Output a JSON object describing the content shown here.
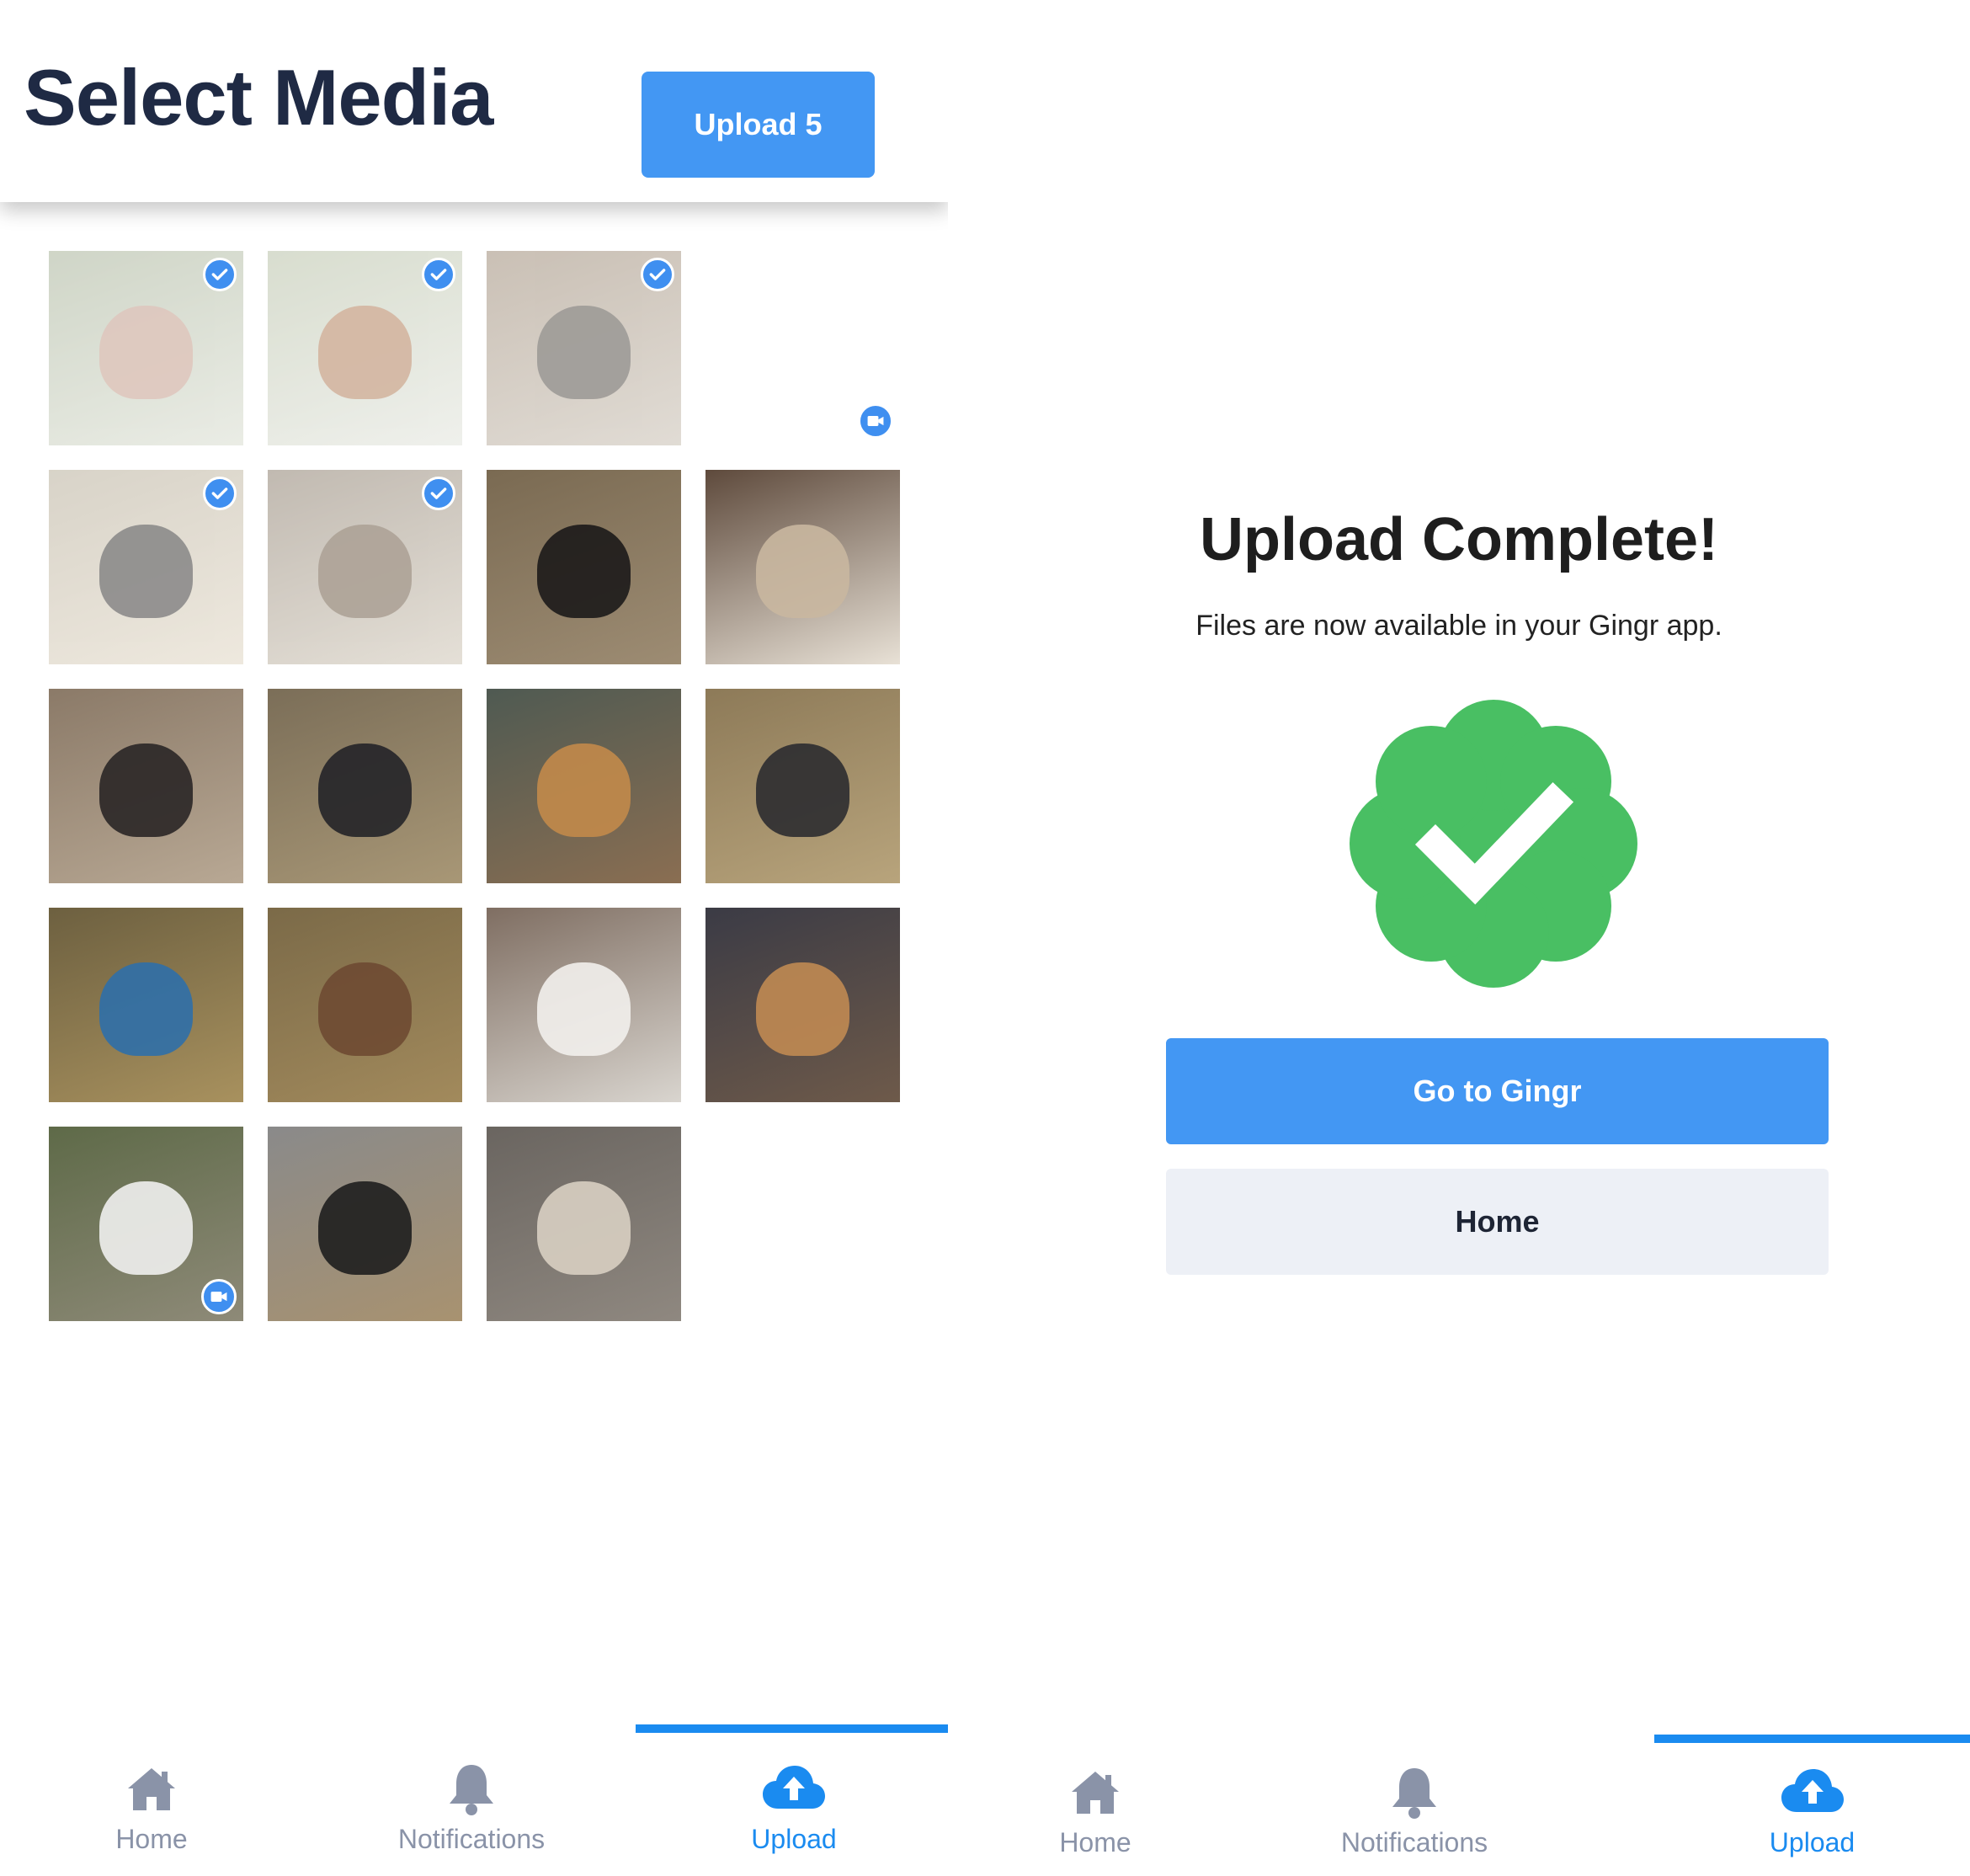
{
  "select_screen": {
    "title": "Select Media",
    "upload_button_label": "Upload 5",
    "tiles": [
      {
        "selected": true,
        "video": false,
        "colors": [
          "#a9b49a",
          "#d9ddd0",
          "#c49a8a"
        ]
      },
      {
        "selected": true,
        "video": false,
        "colors": [
          "#b9c2a8",
          "#e2e4dc",
          "#b07a54"
        ]
      },
      {
        "selected": true,
        "video": false,
        "colors": [
          "#9e8c78",
          "#c8bfb2",
          "#4f4a44"
        ]
      },
      {
        "selected": false,
        "video": true,
        "colors": [
          "#ffffff",
          "#ffffff",
          "#ffffff"
        ],
        "blank": true
      },
      {
        "selected": true,
        "video": false,
        "colors": [
          "#b9b09c",
          "#e0d6c3",
          "#2f2c2c"
        ]
      },
      {
        "selected": true,
        "video": false,
        "colors": [
          "#8f8272",
          "#cfc6b6",
          "#6b5842"
        ]
      },
      {
        "selected": false,
        "video": false,
        "colors": [
          "#7a6a52",
          "#9d8c73",
          "#1c1a1a"
        ]
      },
      {
        "selected": false,
        "video": false,
        "colors": [
          "#5e4a3c",
          "#e8e1d6",
          "#c9b7a0"
        ]
      },
      {
        "selected": false,
        "video": false,
        "colors": [
          "#8b7a68",
          "#b8a894",
          "#2a2626"
        ]
      },
      {
        "selected": false,
        "video": false,
        "colors": [
          "#7b6e58",
          "#a89776",
          "#242428"
        ]
      },
      {
        "selected": false,
        "video": false,
        "colors": [
          "#4f5a52",
          "#8a6e52",
          "#c28a4a"
        ]
      },
      {
        "selected": false,
        "video": false,
        "colors": [
          "#8d7a58",
          "#b8a47c",
          "#2c2c30"
        ]
      },
      {
        "selected": false,
        "video": false,
        "colors": [
          "#6d6040",
          "#a8915e",
          "#2f6fa8"
        ]
      },
      {
        "selected": false,
        "video": false,
        "colors": [
          "#7b6a48",
          "#a28a5c",
          "#6e4a32"
        ]
      },
      {
        "selected": false,
        "video": false,
        "colors": [
          "#7f6e62",
          "#d9d5cf",
          "#f2f0ec"
        ]
      },
      {
        "selected": false,
        "video": false,
        "colors": [
          "#3b3b45",
          "#6e5a4a",
          "#c08a52"
        ]
      },
      {
        "selected": false,
        "video": true,
        "colors": [
          "#5e6a48",
          "#8e8a78",
          "#f0f0ee"
        ]
      },
      {
        "selected": false,
        "video": false,
        "colors": [
          "#8a8a8a",
          "#a89270",
          "#1e1e1e"
        ]
      },
      {
        "selected": false,
        "video": false,
        "colors": [
          "#6a6560",
          "#8f8880",
          "#d8cfc2"
        ]
      }
    ]
  },
  "complete_screen": {
    "title": "Upload Complete!",
    "subtitle": "Files are now available in your Gingr app.",
    "primary_button_label": "Go to Gingr",
    "secondary_button_label": "Home",
    "badge_color": "#49bf63"
  },
  "tabbar": {
    "items": [
      {
        "label": "Home",
        "icon": "home-icon"
      },
      {
        "label": "Notifications",
        "icon": "bell-icon"
      },
      {
        "label": "Upload",
        "icon": "cloud-upload-icon"
      }
    ],
    "active_index": 2,
    "inactive_color": "#8a93a8",
    "active_color": "#1a8bf0"
  }
}
